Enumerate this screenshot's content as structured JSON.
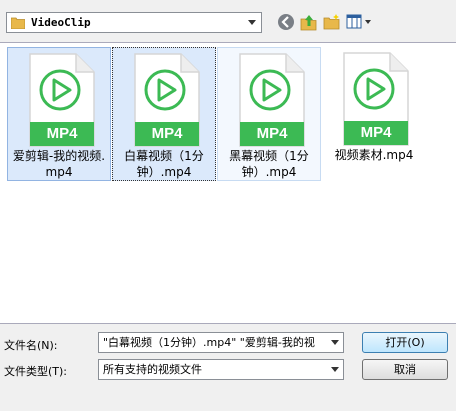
{
  "toolbar": {
    "path": "VideoClip",
    "icons": [
      "folder-icon",
      "back-icon",
      "up-folder-icon",
      "new-folder-icon",
      "view-menu-icon"
    ]
  },
  "files": [
    {
      "badge": "MP4",
      "name": "爱剪辑-我的视频.mp4",
      "state": "selected"
    },
    {
      "badge": "MP4",
      "name": "白幕视频（1分钟）.mp4",
      "state": "focused"
    },
    {
      "badge": "MP4",
      "name": "黑幕视频（1分钟）.mp4",
      "state": "hover"
    },
    {
      "badge": "MP4",
      "name": "视频素材.mp4",
      "state": "normal"
    }
  ],
  "filename": {
    "label": "文件名(N):",
    "value": "\"白幕视频（1分钟）.mp4\" \"爱剪辑-我的视"
  },
  "filetype": {
    "label": "文件类型(T):",
    "value": "所有支持的视频文件"
  },
  "buttons": {
    "open": "打开(O)",
    "cancel": "取消"
  },
  "colors": {
    "mp4_green": "#3cba54",
    "selection": "#dbe9fb"
  }
}
